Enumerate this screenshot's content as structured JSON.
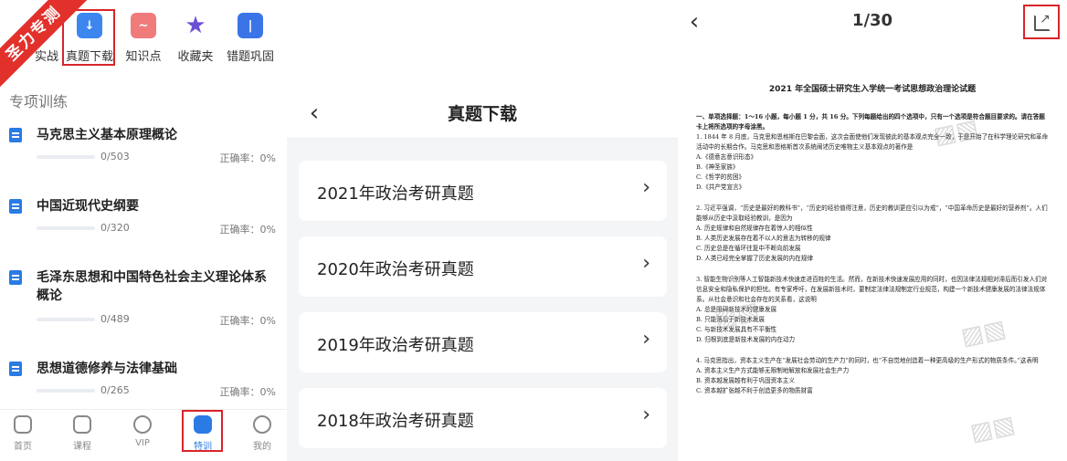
{
  "panel1": {
    "ribbon": "圣力专测",
    "quick_menu": [
      {
        "label": "实战",
        "icon": "practice-icon",
        "color": "#2a7be4",
        "glyph": ""
      },
      {
        "label": "真题下载",
        "icon": "download-icon",
        "color": "#3d86f0",
        "glyph": "↓"
      },
      {
        "label": "知识点",
        "icon": "chart-icon",
        "color": "#f07b7b",
        "glyph": "~"
      },
      {
        "label": "收藏夹",
        "icon": "star-icon",
        "color": "#6b4fd6",
        "glyph": "★"
      },
      {
        "label": "错题巩固",
        "icon": "list-icon",
        "color": "#3b74e6",
        "glyph": "|"
      }
    ],
    "section_title": "专项训练",
    "subjects": [
      {
        "title": "马克思主义基本原理概论",
        "count": "0/503",
        "accuracy": "正确率：0%"
      },
      {
        "title": "中国近现代史纲要",
        "count": "0/320",
        "accuracy": "正确率：0%"
      },
      {
        "title": "毛泽东思想和中国特色社会主义理论体系概论",
        "count": "0/489",
        "accuracy": "正确率：0%"
      },
      {
        "title": "思想道德修养与法律基础",
        "count": "0/265",
        "accuracy": "正确率：0%"
      }
    ],
    "tabs": [
      {
        "label": "首页"
      },
      {
        "label": "课程"
      },
      {
        "label": "VIP"
      },
      {
        "label": "特训"
      },
      {
        "label": "我的"
      }
    ],
    "accent_color": "#2a7be4",
    "highlight_color": "#d9242c"
  },
  "panel2": {
    "title": "真题下载",
    "items": [
      {
        "label": "2021年政治考研真题"
      },
      {
        "label": "2020年政治考研真题"
      },
      {
        "label": "2019年政治考研真题"
      },
      {
        "label": "2018年政治考研真题"
      }
    ]
  },
  "panel3": {
    "pager": "1/30",
    "doc_title": "2021 年全国硕士研究生入学统一考试思想政治理论试题",
    "paragraphs": [
      "一、单项选择题：1～16 小题，每小题 1 分，共 16 分。下列每题给出的四个选项中，只有一个选项是符合题目要求的。请在答题卡上将所选项的字母涂黑。",
      "1. 1844 年 8 月底，马克思和恩格斯在巴黎会面，这次会面使他们发现彼此的基本观点完全一致，于是开始了在科学理论研究和革命活动中的长期合作。马克思和恩格斯首次系统阐述历史唯物主义基本观点的著作是",
      "A.《德意志意识形态》",
      "B.《神圣家族》",
      "C.《哲学的贫困》",
      "D.《共产党宣言》",
      "2. 习近平强调，“历史是最好的教科书”，“历史的经验值得注意，历史的教训更应引以为戒”，“中国革命历史是最好的营养剂”。人们能够从历史中汲取经验教训，是因为",
      "A. 历史规律和自然规律存在着惊人的相似性",
      "B. 人类历史发展存在着不以人的意志为转移的规律",
      "C. 历史总是在循环往复中不断向前发展",
      "D. 人类已经完全掌握了历史发展的内在规律",
      "3. 智能生物识别等人工智能新技术快速走进百姓的生活。然而，在新技术快速发展应用的同时，也因法律法规相对滞后而引发人们对信息安全和隐私保护的担忧。有专家呼吁，在发展新技术时，要制定法律法规制定行业规范，构建一个新技术健康发展的法律法规体系。从社会意识和社会存在的关系看，这说明",
      "A. 总是阻碍新技术的健康发展",
      "B. 只能落后于新技术发展",
      "C. 与新技术发展具有不平衡性",
      "D. 归根到底是新技术发展的内在动力",
      "4. 马克思指出，资本主义生产在“发展社会劳动的生产力”的同时，也“不自觉地创造着一种更高级的生产形式的物质条件。”这表明",
      "A. 资本主义生产方式能够无限制地解放和发展社会生产力",
      "B. 资本越发展越有利于巩固资本主义",
      "C. 资本越扩张越不利于创造更多的物质财富"
    ]
  }
}
